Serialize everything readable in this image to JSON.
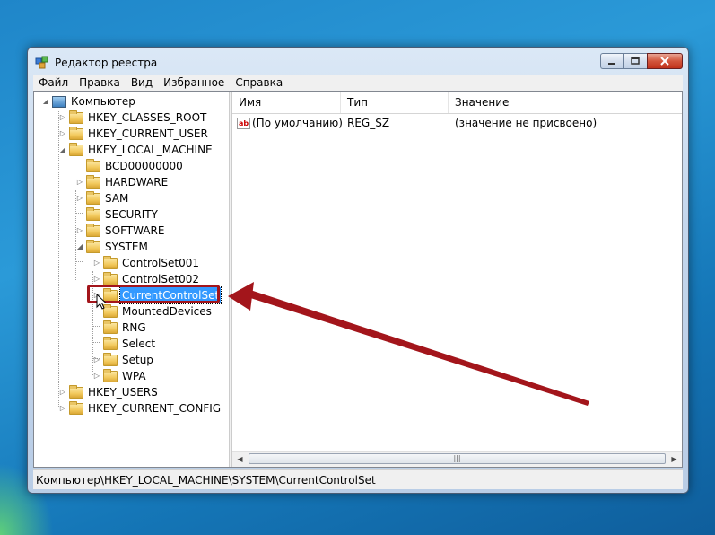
{
  "window": {
    "title": "Редактор реестра"
  },
  "menu": [
    "Файл",
    "Правка",
    "Вид",
    "Избранное",
    "Справка"
  ],
  "tree": {
    "root": "Компьютер",
    "items": [
      {
        "label": "HKEY_CLASSES_ROOT",
        "expanded": false
      },
      {
        "label": "HKEY_CURRENT_USER",
        "expanded": false
      },
      {
        "label": "HKEY_LOCAL_MACHINE",
        "expanded": true
      },
      {
        "label": "BCD00000000",
        "expanded": false
      },
      {
        "label": "HARDWARE",
        "expanded": false
      },
      {
        "label": "SAM",
        "expanded": false
      },
      {
        "label": "SECURITY",
        "expanded": false
      },
      {
        "label": "SOFTWARE",
        "expanded": false
      },
      {
        "label": "SYSTEM",
        "expanded": true
      },
      {
        "label": "ControlSet001",
        "expanded": false
      },
      {
        "label": "ControlSet002",
        "expanded": false
      },
      {
        "label": "CurrentControlSet",
        "expanded": false,
        "selected": true
      },
      {
        "label": "MountedDevices",
        "expanded": false
      },
      {
        "label": "RNG",
        "expanded": false
      },
      {
        "label": "Select",
        "expanded": false
      },
      {
        "label": "Setup",
        "expanded": false
      },
      {
        "label": "WPA",
        "expanded": false
      },
      {
        "label": "HKEY_USERS",
        "expanded": false
      },
      {
        "label": "HKEY_CURRENT_CONFIG",
        "expanded": false
      }
    ]
  },
  "list": {
    "columns": [
      "Имя",
      "Тип",
      "Значение"
    ],
    "rows": [
      {
        "name": "(По умолчанию)",
        "type": "REG_SZ",
        "value": "(значение не присвоено)",
        "icon": "ab"
      }
    ]
  },
  "status": {
    "path": "Компьютер\\HKEY_LOCAL_MACHINE\\SYSTEM\\CurrentControlSet"
  },
  "colors": {
    "annotation": "#a3151b",
    "selection": "#3399ff",
    "close_button": "#c0321b"
  }
}
